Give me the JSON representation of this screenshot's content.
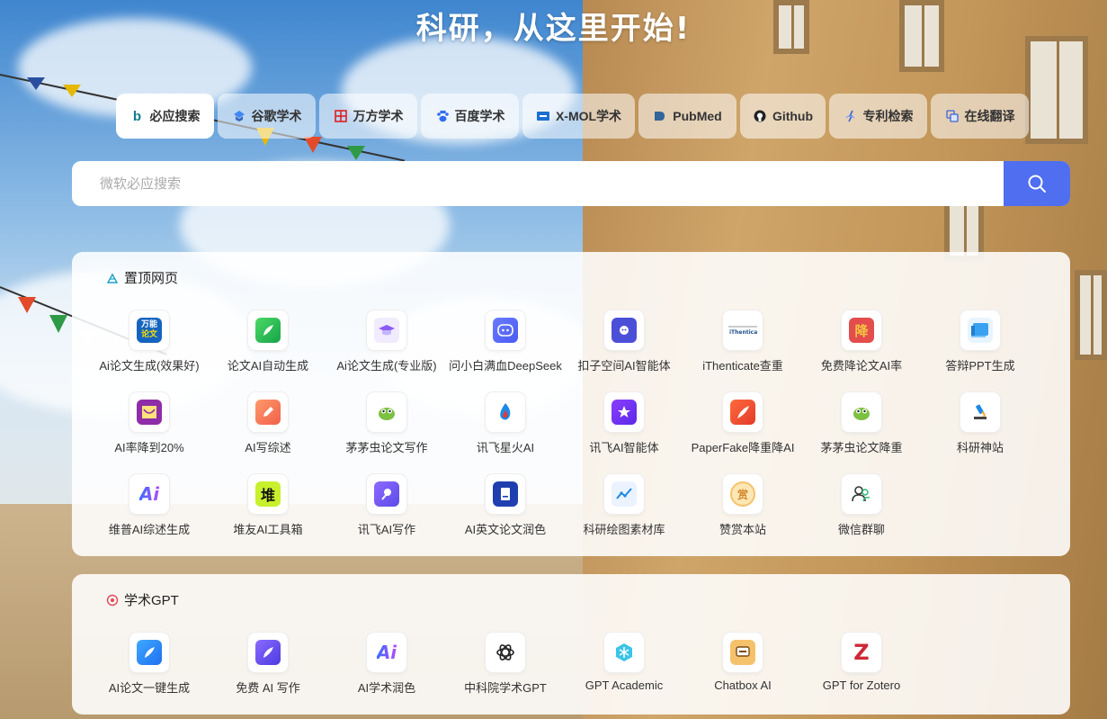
{
  "headline": "科研，从这里开始!",
  "tabs": [
    {
      "label": "必应搜索",
      "icon": "bing-icon",
      "active": true
    },
    {
      "label": "谷歌学术",
      "icon": "google-scholar-icon"
    },
    {
      "label": "万方学术",
      "icon": "wanfang-icon"
    },
    {
      "label": "百度学术",
      "icon": "baidu-paw-icon"
    },
    {
      "label": "X-MOL学术",
      "icon": "xmol-icon"
    },
    {
      "label": "PubMed",
      "icon": "pubmed-icon"
    },
    {
      "label": "Github",
      "icon": "github-icon"
    },
    {
      "label": "专利检索",
      "icon": "patent-icon"
    },
    {
      "label": "在线翻译",
      "icon": "translate-icon"
    }
  ],
  "search": {
    "placeholder": "微软必应搜索"
  },
  "pinned": {
    "title": "置顶网页",
    "items": [
      {
        "label": "Ai论文生成(效果好)",
        "icon": "wanneng-lunwen-icon"
      },
      {
        "label": "论文AI自动生成",
        "icon": "green-feather-icon"
      },
      {
        "label": "Ai论文生成(专业版)",
        "icon": "graduation-cap-icon"
      },
      {
        "label": "问小白满血DeepSeek",
        "icon": "chat-bot-icon"
      },
      {
        "label": "扣子空间AI智能体",
        "icon": "coze-icon"
      },
      {
        "label": "iThenticate查重",
        "icon": "ithenticate-icon"
      },
      {
        "label": "免费降论文AI率",
        "icon": "jiang-icon"
      },
      {
        "label": "答辩PPT生成",
        "icon": "ppt-icon"
      },
      {
        "label": "AI率降到20%",
        "icon": "envelope-icon"
      },
      {
        "label": "AI写综述",
        "icon": "edit-pen-icon"
      },
      {
        "label": "茅茅虫论文写作",
        "icon": "caterpillar-icon"
      },
      {
        "label": "讯飞星火AI",
        "icon": "spark-icon"
      },
      {
        "label": "讯飞AI智能体",
        "icon": "star-agent-icon"
      },
      {
        "label": "PaperFake降重降AI",
        "icon": "quill-icon"
      },
      {
        "label": "茅茅虫论文降重",
        "icon": "caterpillar-icon"
      },
      {
        "label": "科研神站",
        "icon": "microscope-icon"
      },
      {
        "label": "维普AI综述生成",
        "icon": "ai-gradient-icon"
      },
      {
        "label": "堆友AI工具箱",
        "icon": "duiyou-icon"
      },
      {
        "label": "讯飞AI写作",
        "icon": "writing-hand-icon"
      },
      {
        "label": "AI英文论文润色",
        "icon": "document-icon"
      },
      {
        "label": "科研绘图素材库",
        "icon": "chart-line-icon"
      },
      {
        "label": "赞赏本站",
        "icon": "reward-coin-icon"
      },
      {
        "label": "微信群聊",
        "icon": "wechat-group-icon"
      }
    ]
  },
  "gpt": {
    "title": "学术GPT",
    "items": [
      {
        "label": "AI论文一键生成",
        "icon": "blue-feather-icon"
      },
      {
        "label": "免费 AI 写作",
        "icon": "purple-feather-icon"
      },
      {
        "label": "AI学术润色",
        "icon": "ai-gradient-icon"
      },
      {
        "label": "中科院学术GPT",
        "icon": "openai-icon"
      },
      {
        "label": "GPT Academic",
        "icon": "snowflake-icon"
      },
      {
        "label": "Chatbox AI",
        "icon": "chatbox-icon"
      },
      {
        "label": "GPT for Zotero",
        "icon": "zotero-z-icon"
      }
    ]
  },
  "icon_glyphs": {
    "wanneng": "万能",
    "lunwen": "论文",
    "jiang": "降",
    "dui": "堆",
    "zan": "赏",
    "z": "Z",
    "ai": "Ai",
    "b": "b",
    "g": "▲"
  },
  "colors": {
    "accent": "#4f6ef0",
    "headline": "#ffffff"
  }
}
